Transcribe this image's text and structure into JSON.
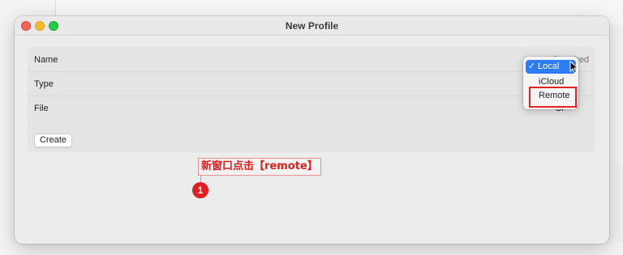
{
  "window": {
    "title": "New Profile"
  },
  "form": {
    "name_label": "Name",
    "name_placeholder": "Required",
    "type_label": "Type",
    "file_label": "File",
    "file_value": "Cr"
  },
  "actions": {
    "create_label": "Create"
  },
  "type_menu": {
    "options": [
      "Local",
      "iCloud",
      "Remote"
    ],
    "selected": "Local",
    "check": "✓"
  },
  "annotation": {
    "text": "新窗口点击【remote】",
    "step": "1",
    "color": "#e01e1e"
  },
  "colors": {
    "accent": "#2f7df6",
    "highlight": "#e22424"
  }
}
